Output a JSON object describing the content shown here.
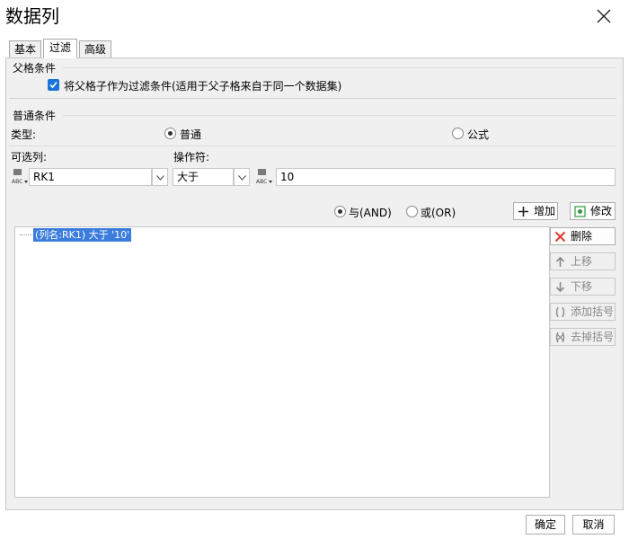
{
  "dialog": {
    "title": "数据列"
  },
  "tabs": [
    {
      "label": "基本",
      "active": false
    },
    {
      "label": "过滤",
      "active": true
    },
    {
      "label": "高级",
      "active": false
    }
  ],
  "parent_condition": {
    "section_label": "父格条件",
    "checkbox_label": "将父格子作为过滤条件(适用于父子格来自于同一个数据集)",
    "checked": true
  },
  "normal_condition": {
    "section_label": "普通条件",
    "type_label": "类型:",
    "type_options": [
      {
        "label": "普通",
        "selected": true
      },
      {
        "label": "公式",
        "selected": false
      }
    ],
    "column_label": "可选列:",
    "column_value": "RK1",
    "operator_label": "操作符:",
    "operator_value": "大于",
    "value_input": "10"
  },
  "logic": {
    "and_label": "与(AND)",
    "and_selected": true,
    "or_label": "或(OR)",
    "or_selected": false
  },
  "actions": {
    "add": "增加",
    "modify": "修改",
    "delete": "删除",
    "move_up": "上移",
    "move_down": "下移",
    "add_bracket": "添加括号",
    "remove_bracket": "去掉括号"
  },
  "conditions": [
    {
      "text": "(列名:RK1) 大于 '10'"
    }
  ],
  "footer": {
    "ok": "确定",
    "cancel": "取消"
  },
  "colors": {
    "accent": "#1a73d8",
    "selection": "#3b7ddd",
    "delete_icon": "#e03c31",
    "modify_icon": "#2e9e3e"
  },
  "icons": [
    "close-icon",
    "abc-column-icon",
    "abc-value-icon",
    "chevron-down-icon",
    "plus-icon",
    "edit-icon",
    "delete-x-icon",
    "arrow-up-icon",
    "arrow-down-icon",
    "add-bracket-icon",
    "remove-bracket-icon"
  ]
}
